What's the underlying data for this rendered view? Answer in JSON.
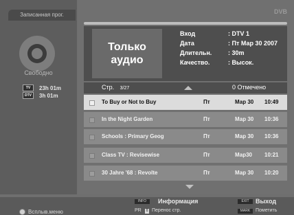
{
  "sidebar": {
    "tab_label": "Записанная прог.",
    "free_label": "Свободно",
    "recordings": [
      {
        "badge": "TV",
        "time": "23h 01m"
      },
      {
        "badge": "DTV",
        "time": "3h 01m"
      }
    ]
  },
  "brand": "DVB",
  "info": {
    "thumb_text": "Только аудио",
    "fields": [
      {
        "label": "Вход",
        "value": ": DTV 1"
      },
      {
        "label": "Дата",
        "value": ": Пт Мар 30 2007"
      },
      {
        "label": "Длительн.",
        "value": ": 30m"
      },
      {
        "label": "Качество.",
        "value": ": Высок."
      }
    ]
  },
  "list": {
    "page_label": "Стр.",
    "page_value": "3/27",
    "marked": "0 Отмечено",
    "rows": [
      {
        "title": "To Buy or Not to Buy",
        "day": "Пт",
        "date": "Мар 30",
        "time": "10:49",
        "selected": true
      },
      {
        "title": "In the Night Garden",
        "day": "Пт",
        "date": "Мар 30",
        "time": "10:36",
        "selected": false
      },
      {
        "title": "Schools : Primary Geog",
        "day": "Пт",
        "date": "Мар 30",
        "time": "10:36",
        "selected": false
      },
      {
        "title": "Class TV : Revisewise",
        "day": "Пт",
        "date": "Мар30",
        "time": "10:21",
        "selected": false
      },
      {
        "title": "30 Jahre '68 : Revolte",
        "day": "Пт",
        "date": "Мар 30",
        "time": "10:20",
        "selected": false
      }
    ]
  },
  "footer": {
    "popup_menu": "Всплыв.меню",
    "info_key": "INFO",
    "info_label": "Информация",
    "pr_key": "PR",
    "pr_label": "Перенос стр.",
    "exit_key": "EXIT",
    "exit_label": "Выход",
    "mark_key": "MARK",
    "mark_label": "Пометить"
  }
}
